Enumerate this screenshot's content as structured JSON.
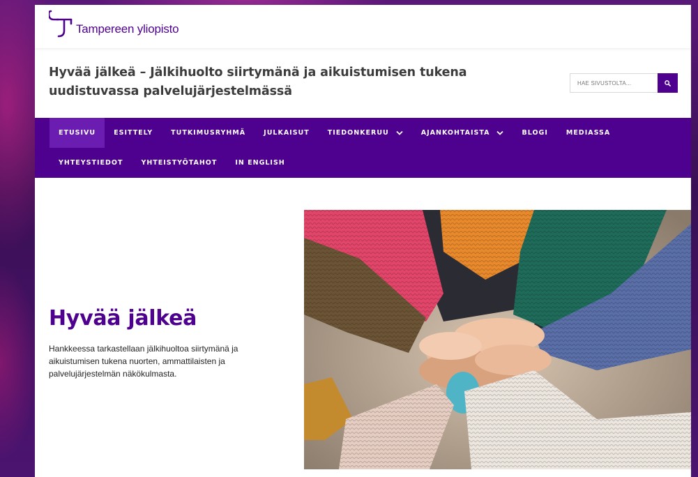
{
  "logo": {
    "text": "Tampereen yliopisto"
  },
  "site_title": "Hyvää jälkeä – Jälkihuolto siirtymänä ja aikuistumisen tukena uudistuvassa palvelujärjestelmässä",
  "search": {
    "placeholder": "HAE SIVUSTOLTA..."
  },
  "nav": {
    "row1": [
      {
        "label": "ETUSIVU",
        "active": true
      },
      {
        "label": "ESITTELY"
      },
      {
        "label": "TUTKIMUSRYHMÄ"
      },
      {
        "label": "JULKAISUT"
      },
      {
        "label": "TIEDONKERUU",
        "dropdown": true
      },
      {
        "label": "AJANKOHTAISTA",
        "dropdown": true
      },
      {
        "label": "BLOGI"
      },
      {
        "label": "MEDIASSA"
      }
    ],
    "row2": [
      {
        "label": "YHTEYSTIEDOT"
      },
      {
        "label": "YHTEISTYÖTAHOT"
      },
      {
        "label": "IN ENGLISH"
      }
    ]
  },
  "hero": {
    "title": "Hyvää jälkeä",
    "text": "Hankkeessa tarkastellaan jälkihuoltoa siirtymänä ja aikuistumisen tukena nuorten, ammattilaisten ja palvelujärjestelmän näkökulmasta."
  },
  "colors": {
    "brand": "#4e008e",
    "nav_active": "#6a1db0",
    "title_text": "#3c3c3c"
  },
  "icons": {
    "search": "search-icon",
    "dropdown": "chevron-down-icon"
  }
}
